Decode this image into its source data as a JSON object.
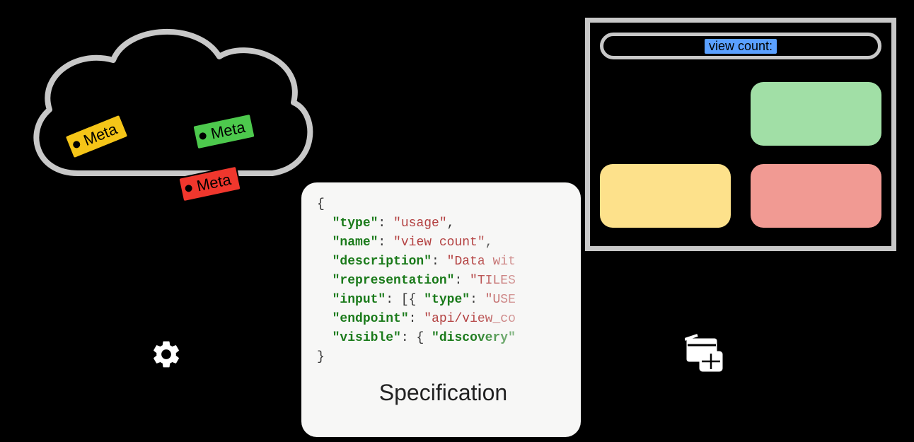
{
  "cloud": {
    "tags": [
      {
        "label": "Meta",
        "color": "yellow"
      },
      {
        "label": "Meta",
        "color": "green"
      },
      {
        "label": "Meta",
        "color": "red"
      }
    ]
  },
  "specification": {
    "title": "Specification",
    "json": {
      "type": "usage",
      "name": "view count",
      "description": "Data wit",
      "representation": "TILES",
      "input_prefix": "[{ ",
      "input_type": "USE",
      "endpoint": "api/view_co",
      "visible_prefix": "{ ",
      "visible_key": "discovery"
    },
    "keys": {
      "type": "\"type\"",
      "name": "\"name\"",
      "description": "\"description\"",
      "representation": "\"representation\"",
      "input": "\"input\"",
      "endpoint": "\"endpoint\"",
      "visible": "\"visible\""
    }
  },
  "browser": {
    "search_highlight": "view count:"
  }
}
